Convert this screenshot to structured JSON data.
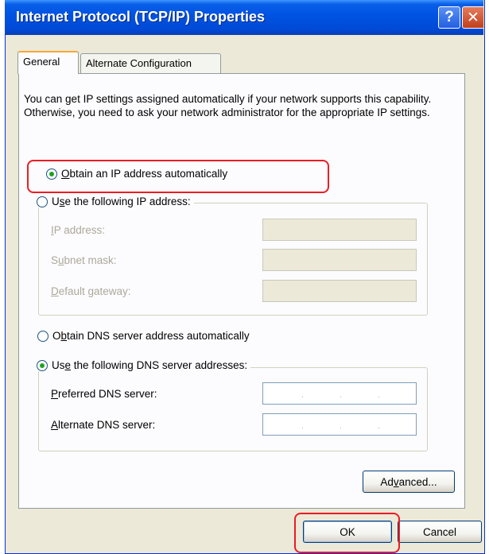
{
  "window": {
    "title": "Internet Protocol (TCP/IP) Properties",
    "help_glyph": "?",
    "close_glyph": "✕",
    "accent": "#0054e3",
    "highlight_color": "#ec1c24"
  },
  "tabs": [
    {
      "label": "General",
      "selected": true
    },
    {
      "label": "Alternate Configuration",
      "selected": false
    }
  ],
  "intro": "You can get IP settings assigned automatically if your network supports this capability. Otherwise, you need to ask your network administrator for the appropriate IP settings.",
  "ip": {
    "auto_label_pre": "",
    "auto_label_key": "O",
    "auto_label_post": "btain an IP address automatically",
    "auto_selected": true,
    "manual_label_pre": "U",
    "manual_label_key": "s",
    "manual_label_post": "e the following IP address:",
    "manual_selected": false,
    "fields": [
      {
        "pre": "",
        "key": "I",
        "post": "P address:",
        "value": ""
      },
      {
        "pre": "S",
        "key": "u",
        "post": "bnet mask:",
        "value": ""
      },
      {
        "pre": "",
        "key": "D",
        "post": "efault gateway:",
        "value": ""
      }
    ]
  },
  "dns": {
    "auto_label_pre": "O",
    "auto_label_key": "b",
    "auto_label_post": "tain DNS server address automatically",
    "auto_selected": false,
    "manual_label_pre": "Us",
    "manual_label_key": "e",
    "manual_label_post": " the following DNS server addresses:",
    "manual_selected": true,
    "fields": [
      {
        "pre": "",
        "key": "P",
        "post": "referred DNS server:",
        "value": ""
      },
      {
        "pre": "",
        "key": "A",
        "post": "lternate DNS server:",
        "value": ""
      }
    ]
  },
  "buttons": {
    "advanced_pre": "Ad",
    "advanced_key": "v",
    "advanced_post": "anced...",
    "ok": "OK",
    "cancel": "Cancel"
  }
}
